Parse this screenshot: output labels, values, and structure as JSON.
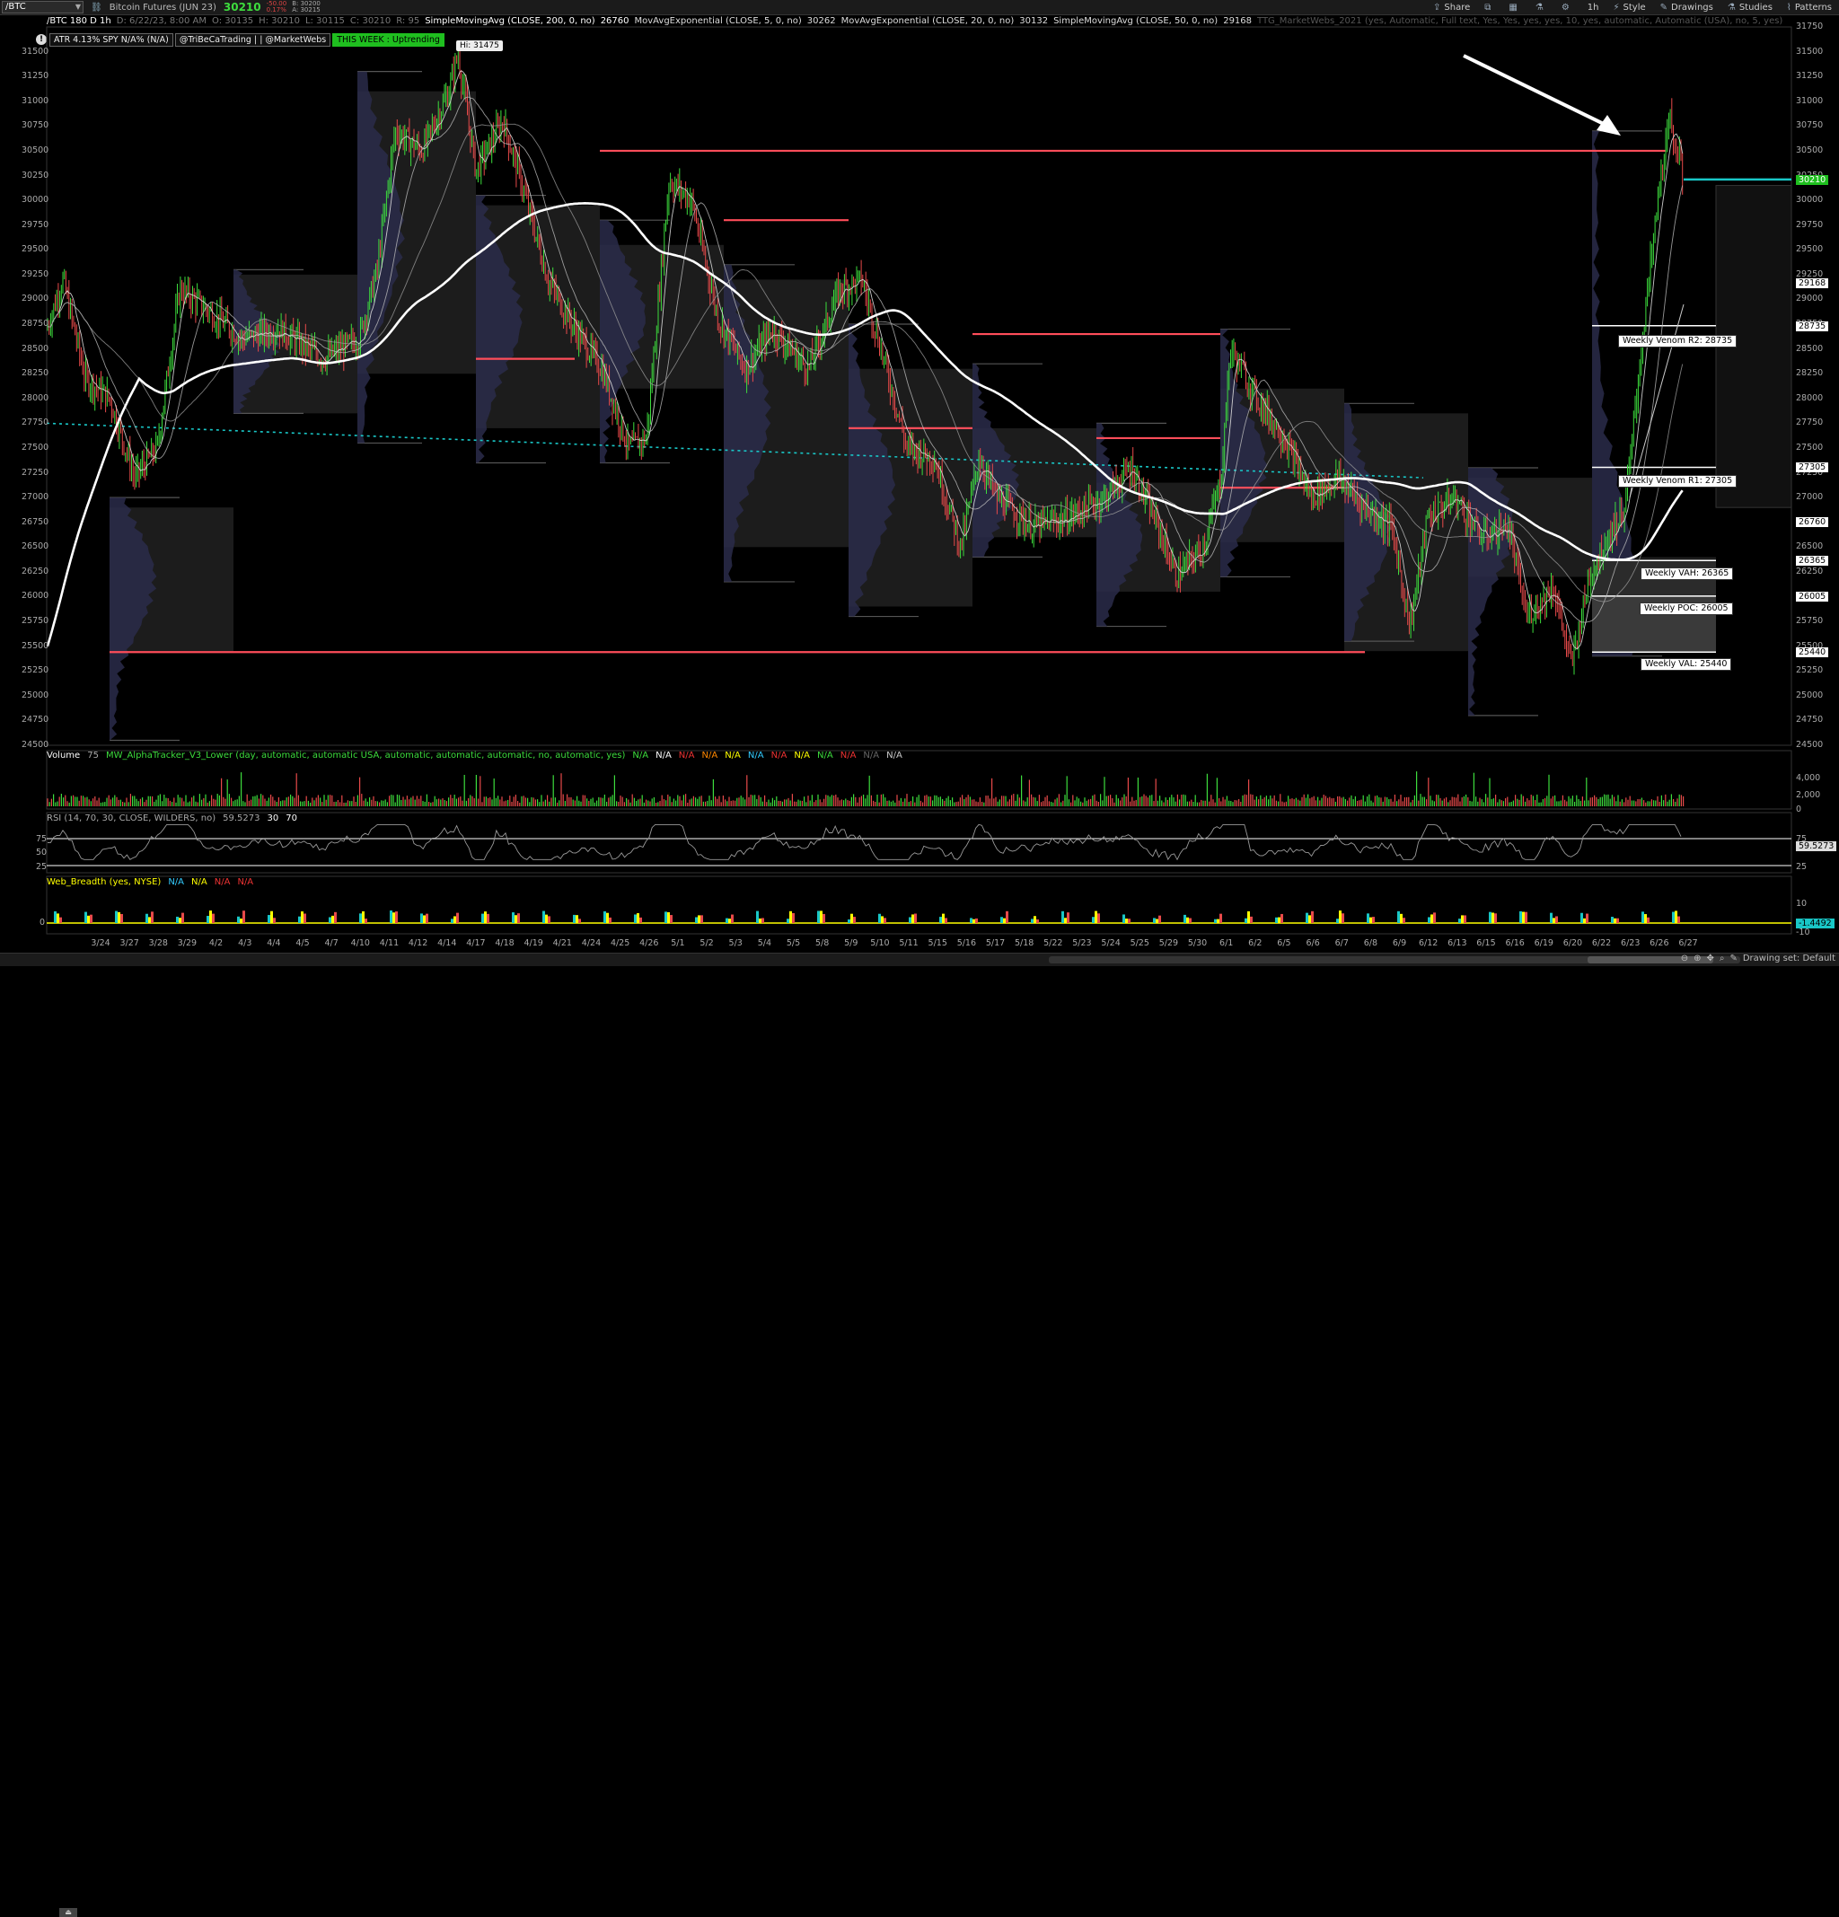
{
  "toolbar": {
    "symbol": "/BTC",
    "instrument": "Bitcoin Futures (JUN 23)",
    "last_price": "30210",
    "change": "-50.00",
    "change_pct": "0.17%",
    "bid": "B: 30200",
    "ask": "A: 30215",
    "share": "Share",
    "timeframe": "1h",
    "style": "Style",
    "drawings": "Drawings",
    "studies": "Studies",
    "patterns": "Patterns"
  },
  "chart_header": {
    "symbol_desc": "/BTC 180 D 1h",
    "ohlc": [
      "D: 6/22/23, 8:00 AM",
      "O: 30135",
      "H: 30210",
      "L: 30115",
      "C: 30210",
      "R: 95"
    ],
    "studies": [
      "SimpleMovingAvg (CLOSE, 200, 0, no)",
      "26760",
      "MovAvgExponential (CLOSE, 5, 0, no)",
      "30262",
      "MovAvgExponential (CLOSE, 20, 0, no)",
      "30132",
      "SimpleMovingAvg (CLOSE, 50, 0, no)",
      "29168"
    ],
    "ttg": "TTG_MarketWebs_2021 (yes, Automatic, Full text, Yes, Yes, yes, yes, 10, yes, automatic, Automatic (USA), no, 5, yes)"
  },
  "badges": {
    "atr": "ATR 4.13% SPY N/A% (N/A)",
    "tribe": "@TriBeCaTrading | | @MarketWebs",
    "week": "THIS WEEK : Uptrending"
  },
  "hi_label": "Hi: 31475",
  "weekly_labels": {
    "r2": "Weekly Venom R2: 28735",
    "r1": "Weekly Venom R1: 27305",
    "vah": "Weekly VAH: 26365",
    "poc": "Weekly POC: 26005",
    "val": "Weekly VAL: 25440"
  },
  "price_axis": [
    "31750",
    "31500",
    "31250",
    "31000",
    "30750",
    "30500",
    "30250",
    "30000",
    "29750",
    "29500",
    "29250",
    "29000",
    "28750",
    "28500",
    "28250",
    "28000",
    "27750",
    "27500",
    "27250",
    "27000",
    "26750",
    "26500",
    "26250",
    "26000",
    "25750",
    "25500",
    "25250",
    "25000",
    "24750",
    "24500"
  ],
  "price_tags": [
    {
      "value": "30210",
      "color": "green"
    },
    {
      "value": "29168",
      "color": "white"
    },
    {
      "value": "28735",
      "color": "white"
    },
    {
      "value": "27305",
      "color": "white"
    },
    {
      "value": "26760",
      "color": "white"
    },
    {
      "value": "26365",
      "color": "white"
    },
    {
      "value": "26005",
      "color": "white"
    },
    {
      "value": "25440",
      "color": "white"
    }
  ],
  "volume_panel": {
    "label": "Volume",
    "value": "75",
    "alpha": "MW_AlphaTracker_V3_Lower (day, automatic, automatic USA, automatic, automatic, automatic, no, automatic, yes)",
    "na_values": [
      "N/A",
      "N/A",
      "N/A",
      "N/A",
      "N/A",
      "N/A",
      "N/A",
      "N/A",
      "N/A",
      "N/A",
      "N/A",
      "N/A"
    ],
    "axis": [
      "4,000",
      "2,000",
      "0"
    ]
  },
  "rsi_panel": {
    "label": "RSI (14, 70, 30, CLOSE, WILDERS, no)",
    "value": "59.5273",
    "ob": "30",
    "os": "70",
    "axis": [
      "75",
      "50",
      "25"
    ],
    "tag": "59.5273"
  },
  "breadth_panel": {
    "label": "Web_Breadth (yes, NYSE)",
    "na_values": [
      "N/A",
      "N/A",
      "N/A",
      "N/A"
    ],
    "axis": [
      "10",
      "0",
      "-10"
    ],
    "tag": "-1.4492"
  },
  "x_axis": [
    "3/24",
    "3/27",
    "3/28",
    "3/29",
    "4/2",
    "4/3",
    "4/4",
    "4/5",
    "4/7",
    "4/10",
    "4/11",
    "4/12",
    "4/14",
    "4/17",
    "4/18",
    "4/19",
    "4/21",
    "4/24",
    "4/25",
    "4/26",
    "5/1",
    "5/2",
    "5/3",
    "5/4",
    "5/5",
    "5/8",
    "5/9",
    "5/10",
    "5/11",
    "5/15",
    "5/16",
    "5/17",
    "5/18",
    "5/22",
    "5/23",
    "5/24",
    "5/25",
    "5/29",
    "5/30",
    "6/1",
    "6/2",
    "6/5",
    "6/6",
    "6/7",
    "6/8",
    "6/9",
    "6/12",
    "6/13",
    "6/15",
    "6/16",
    "6/19",
    "6/20",
    "6/22",
    "6/23",
    "6/26",
    "6/27"
  ],
  "bottom": {
    "drawing_set": "Drawing set: Default"
  }
}
